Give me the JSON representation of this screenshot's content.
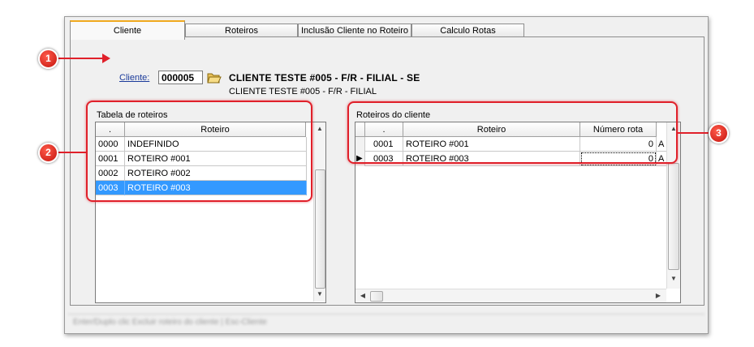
{
  "tabs": [
    "Cliente",
    "Roteiros",
    "Inclusão Cliente no Roteiro",
    "Calculo Rotas"
  ],
  "client": {
    "label": "Cliente:",
    "code": "000005",
    "name_bold": "CLIENTE TESTE #005 - F/R - FILIAL - SE",
    "name": "CLIENTE TESTE #005 - F/R - FILIAL"
  },
  "routes_table": {
    "label": "Tabela de roteiros",
    "columns": [
      ".",
      "Roteiro"
    ],
    "rows": [
      {
        "code": "0000",
        "name": "INDEFINIDO"
      },
      {
        "code": "0001",
        "name": "ROTEIRO #001"
      },
      {
        "code": "0002",
        "name": "ROTEIRO #002"
      },
      {
        "code": "0003",
        "name": "ROTEIRO #003"
      }
    ],
    "selected_index": 3
  },
  "client_routes": {
    "label": "Roteiros do cliente",
    "columns": [
      ".",
      "Roteiro",
      "Número rota"
    ],
    "rows": [
      {
        "code": "0001",
        "name": "ROTEIRO #001",
        "number": "0",
        "extra": "A"
      },
      {
        "code": "0003",
        "name": "ROTEIRO #003",
        "number": "0",
        "extra": "A"
      }
    ]
  },
  "callouts": [
    "1",
    "2",
    "3"
  ],
  "status_text": "Enter/Duplo clic Excluir roteiro do cliente | Esc-Cliente",
  "colors": {
    "highlight": "#e0202a",
    "selection": "#3399ff",
    "active_tab": "#f0a91f"
  }
}
